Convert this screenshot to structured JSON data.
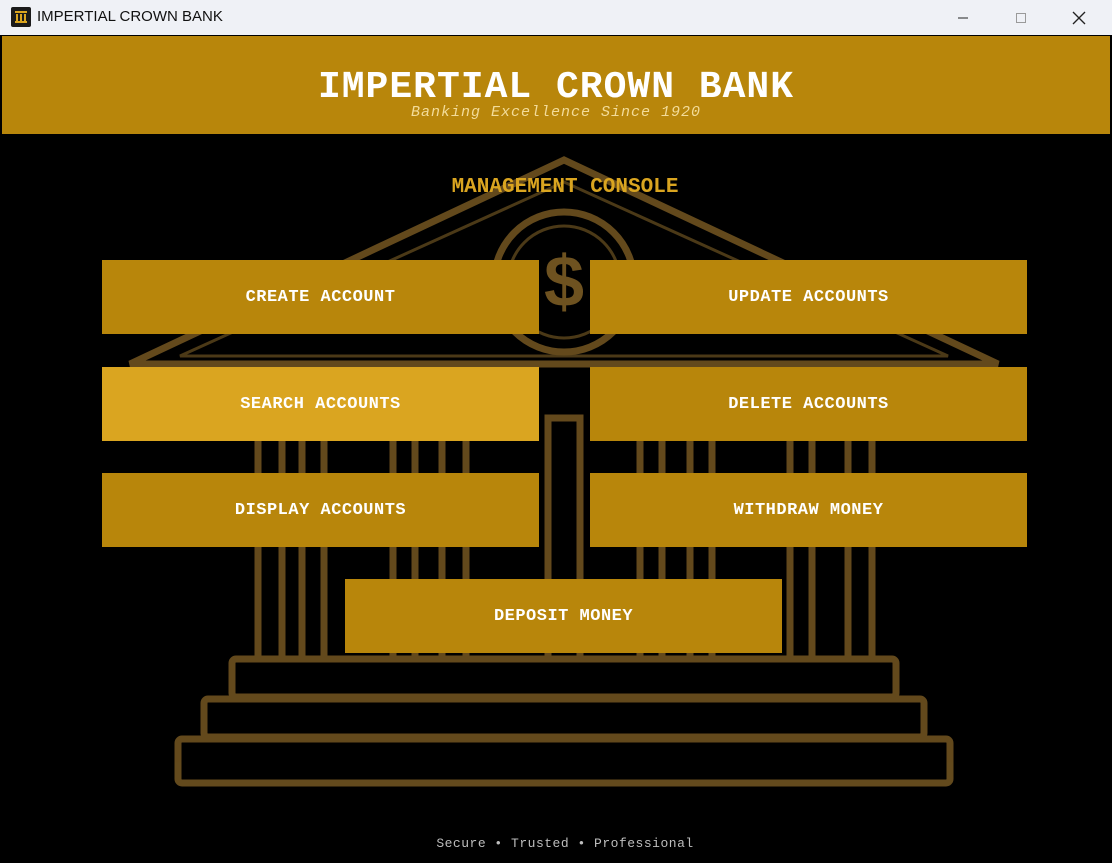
{
  "window": {
    "title": "IMPERTIAL CROWN BANK",
    "app_icon": "bank-columns-icon",
    "controls": [
      "minimize-icon",
      "maximize-icon",
      "close-icon"
    ]
  },
  "header": {
    "title": "IMPERTIAL CROWN BANK",
    "subtitle": "Banking Excellence Since 1920"
  },
  "main": {
    "section_title": "MANAGEMENT CONSOLE",
    "buttons": [
      {
        "label": "CREATE ACCOUNT"
      },
      {
        "label": "UPDATE ACCOUNTS"
      },
      {
        "label": "SEARCH ACCOUNTS"
      },
      {
        "label": "DELETE ACCOUNTS"
      },
      {
        "label": "DISPLAY ACCOUNTS"
      },
      {
        "label": "WITHDRAW MONEY"
      },
      {
        "label": "DEPOSIT MONEY"
      }
    ],
    "background_art": "bank-building-icon"
  },
  "footer": {
    "text": "Secure • Trusted • Professional"
  },
  "colors": {
    "gold": "#b8860b",
    "gold_hover": "#daa520",
    "background": "#000000",
    "white": "#ffffff"
  }
}
